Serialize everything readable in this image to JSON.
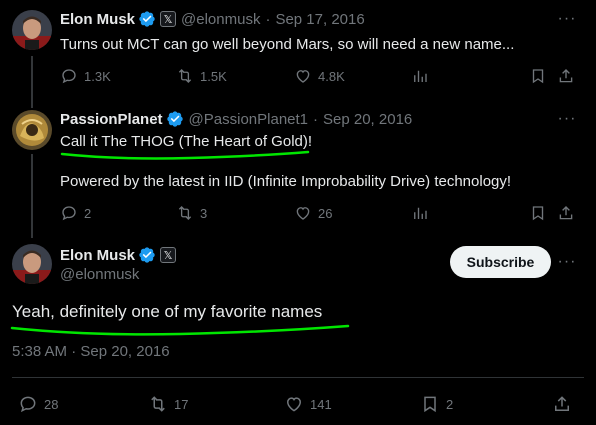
{
  "tweets": [
    {
      "name": "Elon Musk",
      "handle": "@elonmusk",
      "separator": "·",
      "date": "Sep 17, 2016",
      "text": "Turns out MCT can go well beyond Mars, so will need a new name...",
      "replies": "1.3K",
      "reposts": "1.5K",
      "likes": "4.8K"
    },
    {
      "name": "PassionPlanet",
      "handle": "@PassionPlanet1",
      "separator": "·",
      "date": "Sep 20, 2016",
      "text_line1": "Call it The THOG (The Heart of Gold)!",
      "text_line2": "Powered by the latest in IID (Infinite Improbability Drive)  technology!",
      "replies": "2",
      "reposts": "3",
      "likes": "26"
    }
  ],
  "main_tweet": {
    "name": "Elon Musk",
    "handle": "@elonmusk",
    "subscribe_label": "Subscribe",
    "text": "Yeah, definitely one of my favorite names",
    "timestamp": "5:38 AM · Sep 20, 2016",
    "replies": "28",
    "reposts": "17",
    "likes": "141",
    "bookmarks": "2"
  },
  "more_glyph": "···",
  "x_badge_glyph": "𝕏",
  "colors": {
    "background": "#000000",
    "text_primary": "#e7e9ea",
    "text_secondary": "#71767b",
    "verified_blue": "#1d9bf0",
    "highlight_green": "#00e600",
    "divider": "#2f3336"
  }
}
